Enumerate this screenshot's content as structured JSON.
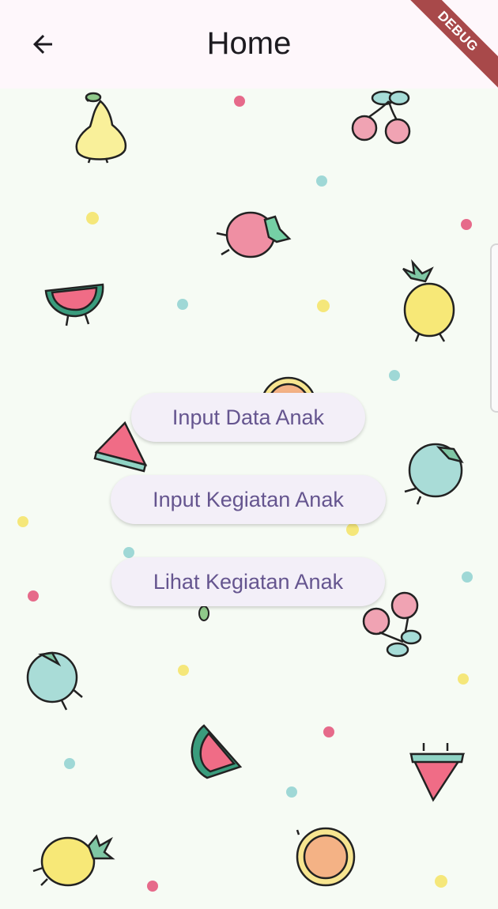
{
  "appbar": {
    "title": "Home",
    "back_icon": "arrow-back-icon"
  },
  "debug_banner": "DEBUG",
  "menu": {
    "buttons": [
      {
        "label": "Input Data Anak"
      },
      {
        "label": "Input Kegiatan Anak"
      },
      {
        "label": "Lihat Kegiatan Anak"
      }
    ]
  },
  "colors": {
    "background": "#f6fbf4",
    "appbar": "#fef7fb",
    "button_bg": "#f3eff8",
    "button_text": "#65558f",
    "debug_ribbon": "#a8494a"
  }
}
